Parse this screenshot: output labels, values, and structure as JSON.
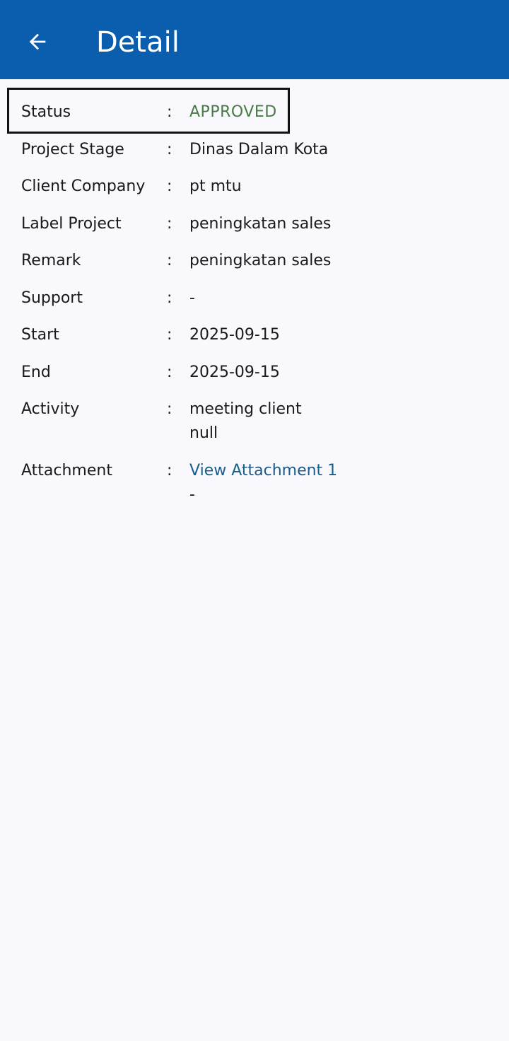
{
  "app_bar": {
    "title": "Detail",
    "back_icon": "arrow-left-icon"
  },
  "colors": {
    "app_bar": "#0b5ead",
    "background": "#f8f8fd",
    "status_approved": "#4a7a46",
    "link": "#1a5c8a"
  },
  "fields": {
    "separator": ":",
    "status": {
      "label": "Status",
      "value": "APPROVED"
    },
    "project_stage": {
      "label": "Project Stage",
      "value": "Dinas Dalam Kota"
    },
    "client_company": {
      "label": "Client Company",
      "value": "pt mtu"
    },
    "label_project": {
      "label": "Label Project",
      "value": "peningkatan sales"
    },
    "remark": {
      "label": "Remark",
      "value": "peningkatan sales"
    },
    "support": {
      "label": "Support",
      "value": "-"
    },
    "start": {
      "label": "Start",
      "value": "2025-09-15"
    },
    "end": {
      "label": "End",
      "value": "2025-09-15"
    },
    "activity": {
      "label": "Activity",
      "line1": "meeting client",
      "line2": "null"
    },
    "attachment": {
      "label": "Attachment",
      "link": "View Attachment 1",
      "line2": "-"
    }
  }
}
